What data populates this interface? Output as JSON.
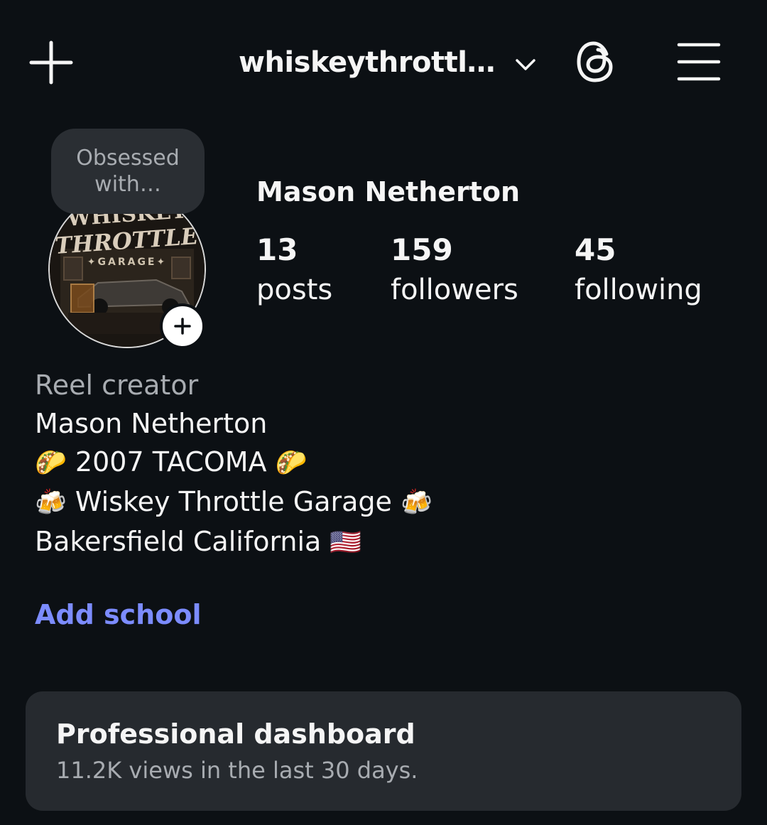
{
  "header": {
    "username": "whiskeythrottl…",
    "new_post_icon": "plus-icon",
    "switch_icon": "chevron-down-icon",
    "threads_icon": "threads-icon",
    "menu_icon": "hamburger-menu-icon"
  },
  "profile": {
    "note": "Obsessed with…",
    "avatar_logo_lines": [
      "WHISKEY",
      "THROTTLE",
      "GARAGE"
    ],
    "full_name": "Mason Netherton",
    "stats": [
      {
        "count": "13",
        "label": "posts"
      },
      {
        "count": "159",
        "label": "followers"
      },
      {
        "count": "45",
        "label": "following"
      }
    ]
  },
  "bio": {
    "category": "Reel creator",
    "name_line": "Mason Netherton",
    "line2": {
      "emoji_left": "🌮",
      "text": "2007 TACOMA",
      "emoji_right": "🌮"
    },
    "line3": {
      "emoji_left": "🍻",
      "text": "Wiskey Throttle Garage",
      "emoji_right": "🍻"
    },
    "line4": {
      "text": "Bakersfield California",
      "emoji_right": "🇺🇸"
    }
  },
  "add_school": "Add school",
  "dashboard": {
    "title": "Professional dashboard",
    "subtitle": "11.2K views in the last 30 days."
  },
  "colors": {
    "background": "#0c1014",
    "link": "#7c8cff",
    "card": "#262a2f",
    "muted_text": "#a8acb1"
  }
}
